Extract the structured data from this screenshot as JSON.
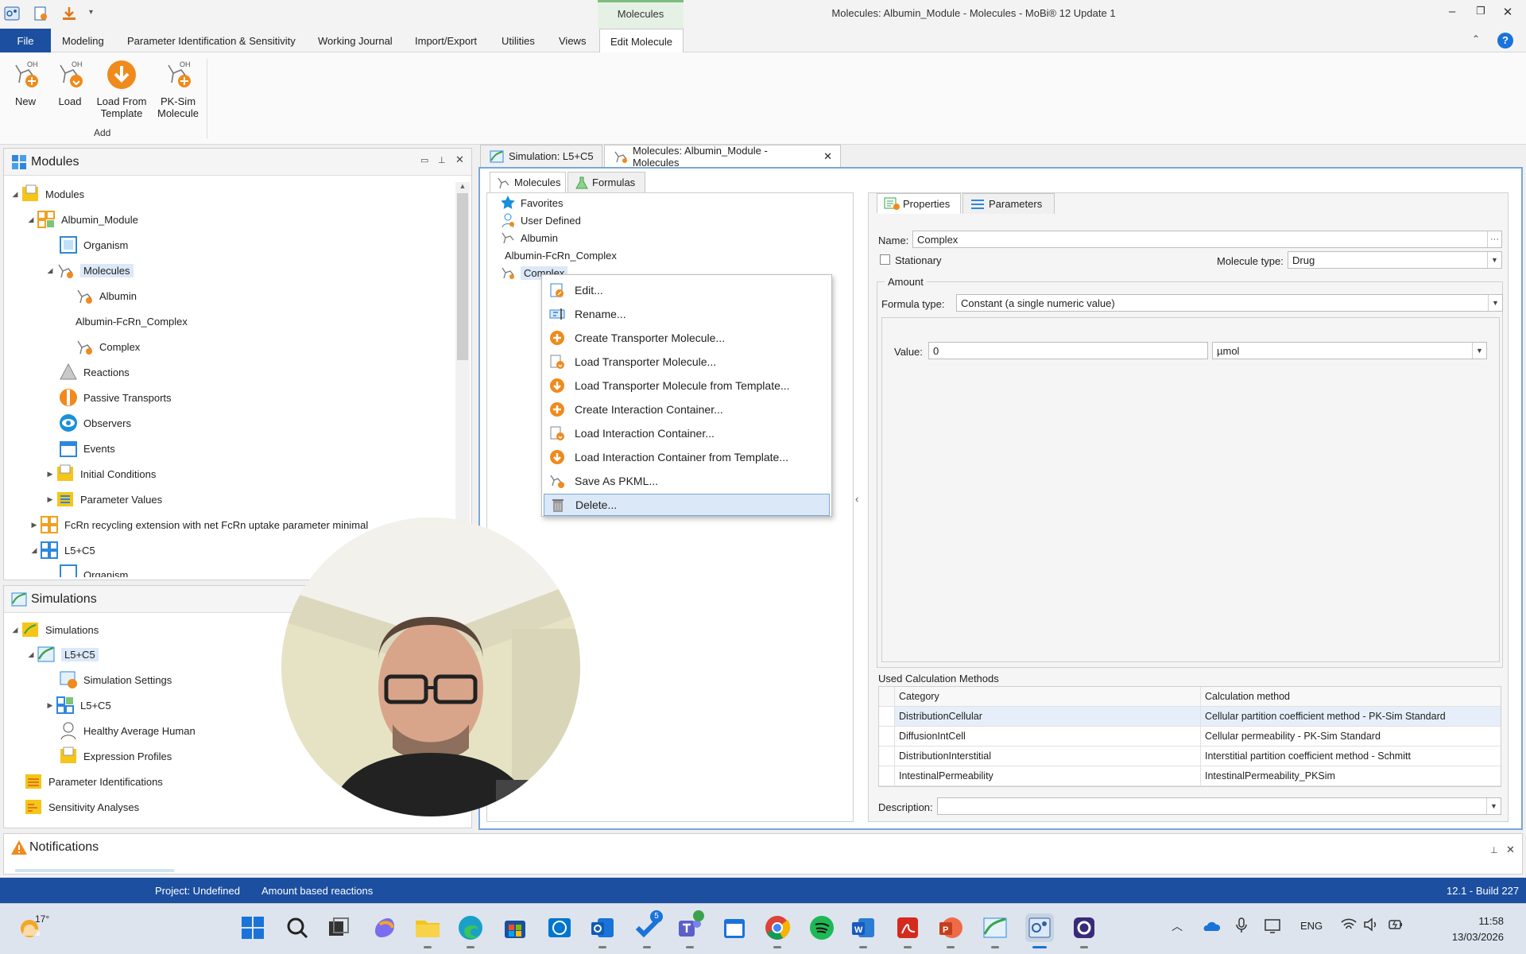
{
  "window": {
    "title": "Molecules: Albumin_Module - Molecules - MoBi® 12 Update 1",
    "context_tab": "Molecules"
  },
  "ribbon_tabs": [
    "File",
    "Modeling",
    "Parameter Identification & Sensitivity",
    "Working Journal",
    "Import/Export",
    "Utilities",
    "Views",
    "Edit Molecule"
  ],
  "ribbon": {
    "buttons": [
      "New",
      "Load",
      "Load From\nTemplate",
      "PK-Sim\nMolecule"
    ],
    "btn_new": "New",
    "btn_load": "Load",
    "btn_template_1": "Load From",
    "btn_template_2": "Template",
    "btn_pksim_1": "PK-Sim",
    "btn_pksim_2": "Molecule",
    "group": "Add"
  },
  "modules_panel": {
    "title": "Modules",
    "tree": {
      "root": "Modules",
      "albumin_module": "Albumin_Module",
      "organism": "Organism",
      "molecules": "Molecules",
      "albumin": "Albumin",
      "albumin_fcrn": "Albumin-FcRn_Complex",
      "complex": "Complex",
      "reactions": "Reactions",
      "passive": "Passive Transports",
      "observers": "Observers",
      "events": "Events",
      "initial": "Initial Conditions",
      "paramvals": "Parameter Values",
      "fcrn": "FcRn recycling extension with net FcRn uptake parameter minimal",
      "l5c5": "L5+C5",
      "organism2": "Organism"
    }
  },
  "simulations_panel": {
    "title": "Simulations",
    "tree": {
      "root": "Simulations",
      "l5c5": "L5+C5",
      "settings": "Simulation Settings",
      "l5c5_child": "L5+C5",
      "human": "Healthy Average Human",
      "expr": "Expression Profiles",
      "pid": "Parameter Identifications",
      "sens": "Sensitivity Analyses"
    }
  },
  "notifications_panel": {
    "title": "Notifications"
  },
  "doc_tabs": {
    "sim": "Simulation: L5+C5",
    "mol": "Molecules: Albumin_Module - Molecules"
  },
  "sub_tabs": {
    "molecules": "Molecules",
    "formulas": "Formulas"
  },
  "mol_tree": {
    "favorites": "Favorites",
    "user_defined": "User Defined",
    "albumin": "Albumin",
    "albumin_fcrn": "Albumin-FcRn_Complex",
    "complex": "Complex"
  },
  "context_menu": {
    "edit": "Edit...",
    "rename": "Rename...",
    "create_transporter": "Create Transporter Molecule...",
    "load_transporter": "Load Transporter Molecule...",
    "load_transporter_tpl": "Load Transporter Molecule from Template...",
    "create_interaction": "Create Interaction Container...",
    "load_interaction": "Load Interaction Container...",
    "load_interaction_tpl": "Load Interaction Container from Template...",
    "save_pkml": "Save As PKML...",
    "delete": "Delete..."
  },
  "props": {
    "tab_properties": "Properties",
    "tab_parameters": "Parameters",
    "name_label": "Name:",
    "name_value": "Complex",
    "stationary": "Stationary",
    "molecule_type_label": "Molecule type:",
    "molecule_type_value": "Drug",
    "amount_group": "Amount",
    "formula_type_label": "Formula type:",
    "formula_type_value": "Constant (a single numeric value)",
    "value_label": "Value:",
    "value": "0",
    "unit": "µmol",
    "ucm_label": "Used Calculation Methods",
    "col_category": "Category",
    "col_method": "Calculation method",
    "rows": [
      {
        "category": "DistributionCellular",
        "method": "Cellular partition coefficient method - PK-Sim Standard"
      },
      {
        "category": "DiffusionIntCell",
        "method": "Cellular permeability - PK-Sim Standard"
      },
      {
        "category": "DistributionInterstitial",
        "method": "Interstitial partition coefficient method - Schmitt"
      },
      {
        "category": "IntestinalPermeability",
        "method": "IntestinalPermeability_PKSim"
      }
    ],
    "description_label": "Description:"
  },
  "statusbar": {
    "project": "Project: Undefined",
    "mode": "Amount based reactions",
    "version": "12.1 - Build 227"
  },
  "taskbar": {
    "weather": "17°",
    "lang": "ENG",
    "time": "11:58",
    "date": "13/03/2026",
    "todo_badge": "5"
  },
  "colors": {
    "accent_blue": "#1c4fa0",
    "orange": "#f08a1c",
    "selection": "#dbe8f7"
  }
}
